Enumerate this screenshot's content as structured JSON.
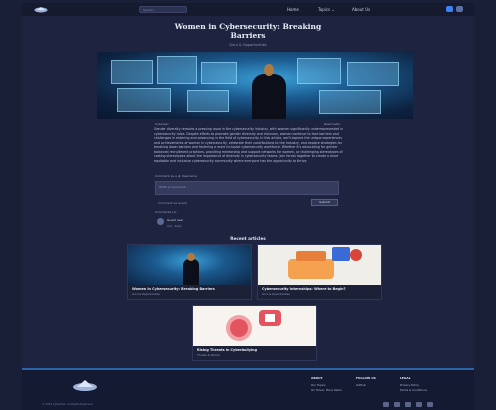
{
  "nav": {
    "search_placeholder": "Search...",
    "links": [
      "Home",
      "Topics ⌄",
      "About Us"
    ],
    "accent": "#3b82f6"
  },
  "article": {
    "title": "Women in Cybersecurity: Breaking Barriers",
    "byline": "Guru & Opportunities",
    "meta_left": "Cybersec",
    "meta_right": "Read Later",
    "body": "Gender diversity remains a pressing issue in the cybersecurity industry, with women significantly underrepresented in cybersecurity roles. Despite efforts to promote gender diversity and inclusion, women continue to face barriers and challenges in entering and advancing in the field of cybersecurity. In this article, we'll explore the unique experiences and achievements of women in cybersecurity, celebrate their contributions to the industry, and explore strategies for breaking down barriers and fostering a more inclusive cybersecurity workforce. Whether it's advocating for gender balanced recruitment practices, providing mentorship and support networks for women, or challenging stereotypes of casting stereotypes about the importance of diversity in cybersecurity teams. Join forces together to create a more equitable and inclusive cybersecurity community where everyone has the opportunity to thrive."
  },
  "comment": {
    "label": "Comment as a @ Username",
    "placeholder": "Write a comment...",
    "meta": "Comment as Guest",
    "submit": "Submit",
    "count_label": "Comments (1)",
    "author": "Guest user",
    "author_meta": "Like · Reply"
  },
  "recent": {
    "title": "Recent articles",
    "cards": [
      {
        "title": "Women in Cybersecurity: Breaking Barriers",
        "author": "Guru & Opportunities"
      },
      {
        "title": "Cybersecurity Internships: Where to Begin?",
        "author": "Guru & Opportunities"
      },
      {
        "title": "Rising Threats in Cyberbullying",
        "author": "Threats & Attacks"
      }
    ]
  },
  "footer": {
    "cols": [
      {
        "title": "ABOUT",
        "links": [
          "Our Topics",
          "On Hover, More Items"
        ]
      },
      {
        "title": "FOLLOW US",
        "links": [
          "GitHub"
        ]
      },
      {
        "title": "LEGAL",
        "links": [
          "Privacy Policy",
          "Terms & Conditions"
        ]
      }
    ],
    "copyright": "© 2024 CyberHub. All Rights Reserved.",
    "accent": "#2c62a8"
  }
}
